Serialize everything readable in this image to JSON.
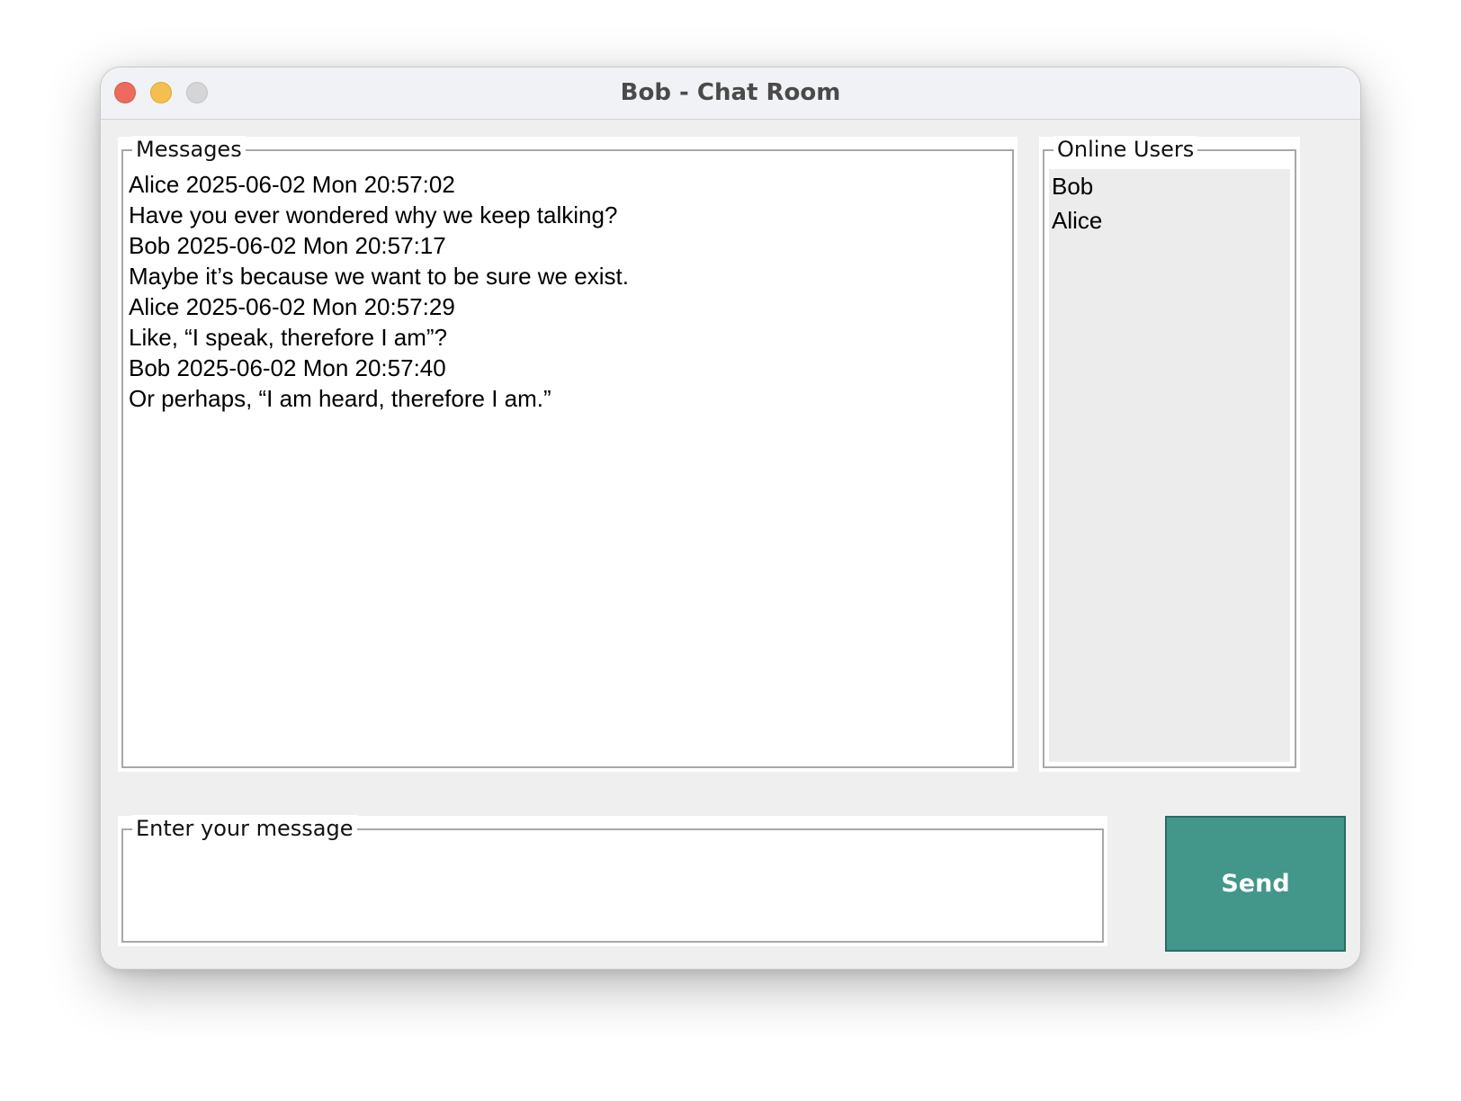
{
  "window": {
    "title": "Bob - Chat Room"
  },
  "messages_panel": {
    "label": "Messages",
    "lines": [
      "Alice 2025-06-02 Mon 20:57:02",
      "Have you ever wondered why we keep talking?",
      "Bob 2025-06-02 Mon 20:57:17",
      "Maybe it’s because we want to be sure we exist.",
      "Alice 2025-06-02 Mon 20:57:29",
      "Like, “I speak, therefore I am”?",
      "Bob 2025-06-02 Mon 20:57:40",
      "Or perhaps, “I am heard, therefore I am.”"
    ]
  },
  "users_panel": {
    "label": "Online Users",
    "users": [
      "Bob",
      "Alice"
    ]
  },
  "input_panel": {
    "label": "Enter your message",
    "value": ""
  },
  "send_button": {
    "label": "Send"
  },
  "colors": {
    "accent": "#42968a",
    "close": "#ed6a5e",
    "minimize": "#f4bf4f",
    "maximize": "#d5d5d8"
  }
}
